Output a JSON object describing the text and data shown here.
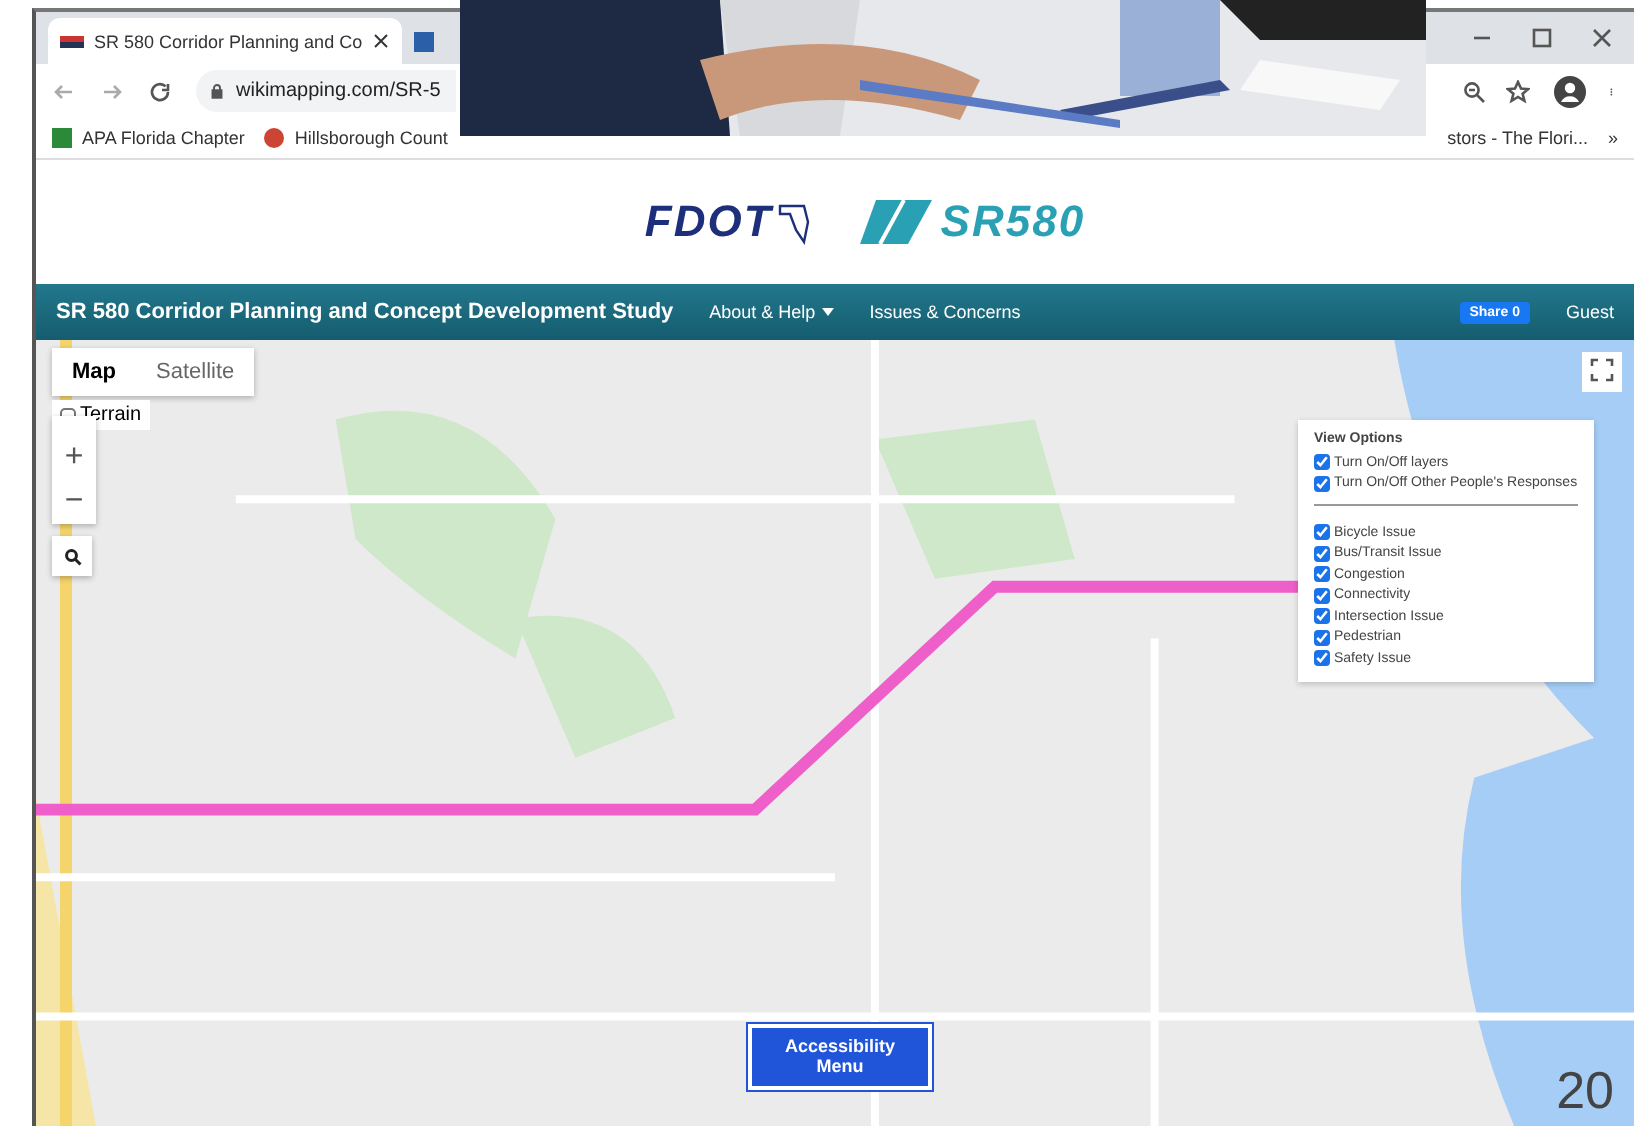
{
  "browser": {
    "tabs": [
      {
        "label": "SR 580 Corridor Planning and Co",
        "selected": true
      },
      {
        "selected": false
      }
    ],
    "address": "wikimapping.com/SR-5",
    "bookmarks": [
      {
        "label": "APA Florida Chapter"
      },
      {
        "label": "Hillsborough Count"
      },
      {
        "label": "stors - The Flori..."
      }
    ],
    "more_bookmarks": "»"
  },
  "header": {
    "logo_left": "FDOT",
    "logo_right": "SR580"
  },
  "navbar": {
    "title": "SR 580 Corridor Planning and Concept Development Study",
    "menu": [
      {
        "label": "About & Help",
        "kind": "dropdown"
      },
      {
        "label": "Issues & Concerns",
        "kind": "link"
      }
    ],
    "share": "Share 0",
    "user": "Guest"
  },
  "map": {
    "map_types": [
      {
        "label": "Map",
        "selected": true
      },
      {
        "label": "Satellite",
        "selected": false
      }
    ],
    "terrain": {
      "label": "Terrain",
      "checked": false
    },
    "zoom_in": "+",
    "zoom_out": "−",
    "view_options": {
      "title": "View Options",
      "toggles": [
        {
          "label": "Turn On/Off layers",
          "checked": true
        },
        {
          "label": "Turn On/Off Other People's Responses",
          "checked": true
        }
      ],
      "categories": [
        {
          "label": "Bicycle Issue",
          "checked": true
        },
        {
          "label": "Bus/Transit Issue",
          "checked": true
        },
        {
          "label": "Congestion",
          "checked": true
        },
        {
          "label": "Connectivity",
          "checked": true
        },
        {
          "label": "Intersection Issue",
          "checked": true
        },
        {
          "label": "Pedestrian",
          "checked": true
        },
        {
          "label": "Safety Issue",
          "checked": true
        }
      ]
    },
    "accessibility_button": "Accessibility Menu"
  },
  "page_number": "20"
}
